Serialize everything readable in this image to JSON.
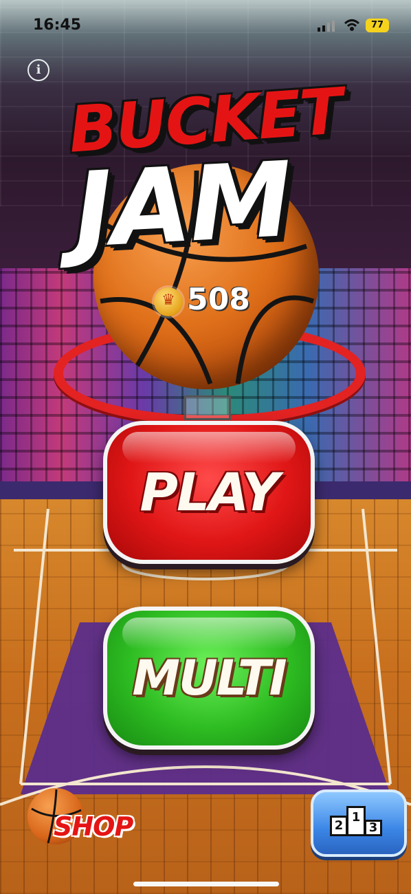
{
  "status_bar": {
    "time": "16:45",
    "battery": "77"
  },
  "info_icon_glyph": "i",
  "title": {
    "line1": "BUCKET",
    "line2": "JAM"
  },
  "coins": {
    "icon": "crown-coin-icon",
    "count": "508"
  },
  "buttons": {
    "play_label": "PLAY",
    "multi_label": "MULTI",
    "shop_label": "SHOP"
  },
  "leaderboard": {
    "icon": "podium-icon",
    "ranks": [
      "2",
      "1",
      "3"
    ]
  },
  "colors": {
    "play": "#e01616",
    "multi": "#2ebd22",
    "leaderboard": "#3b86e6",
    "rim": "#e32222",
    "title_red": "#e51414"
  }
}
